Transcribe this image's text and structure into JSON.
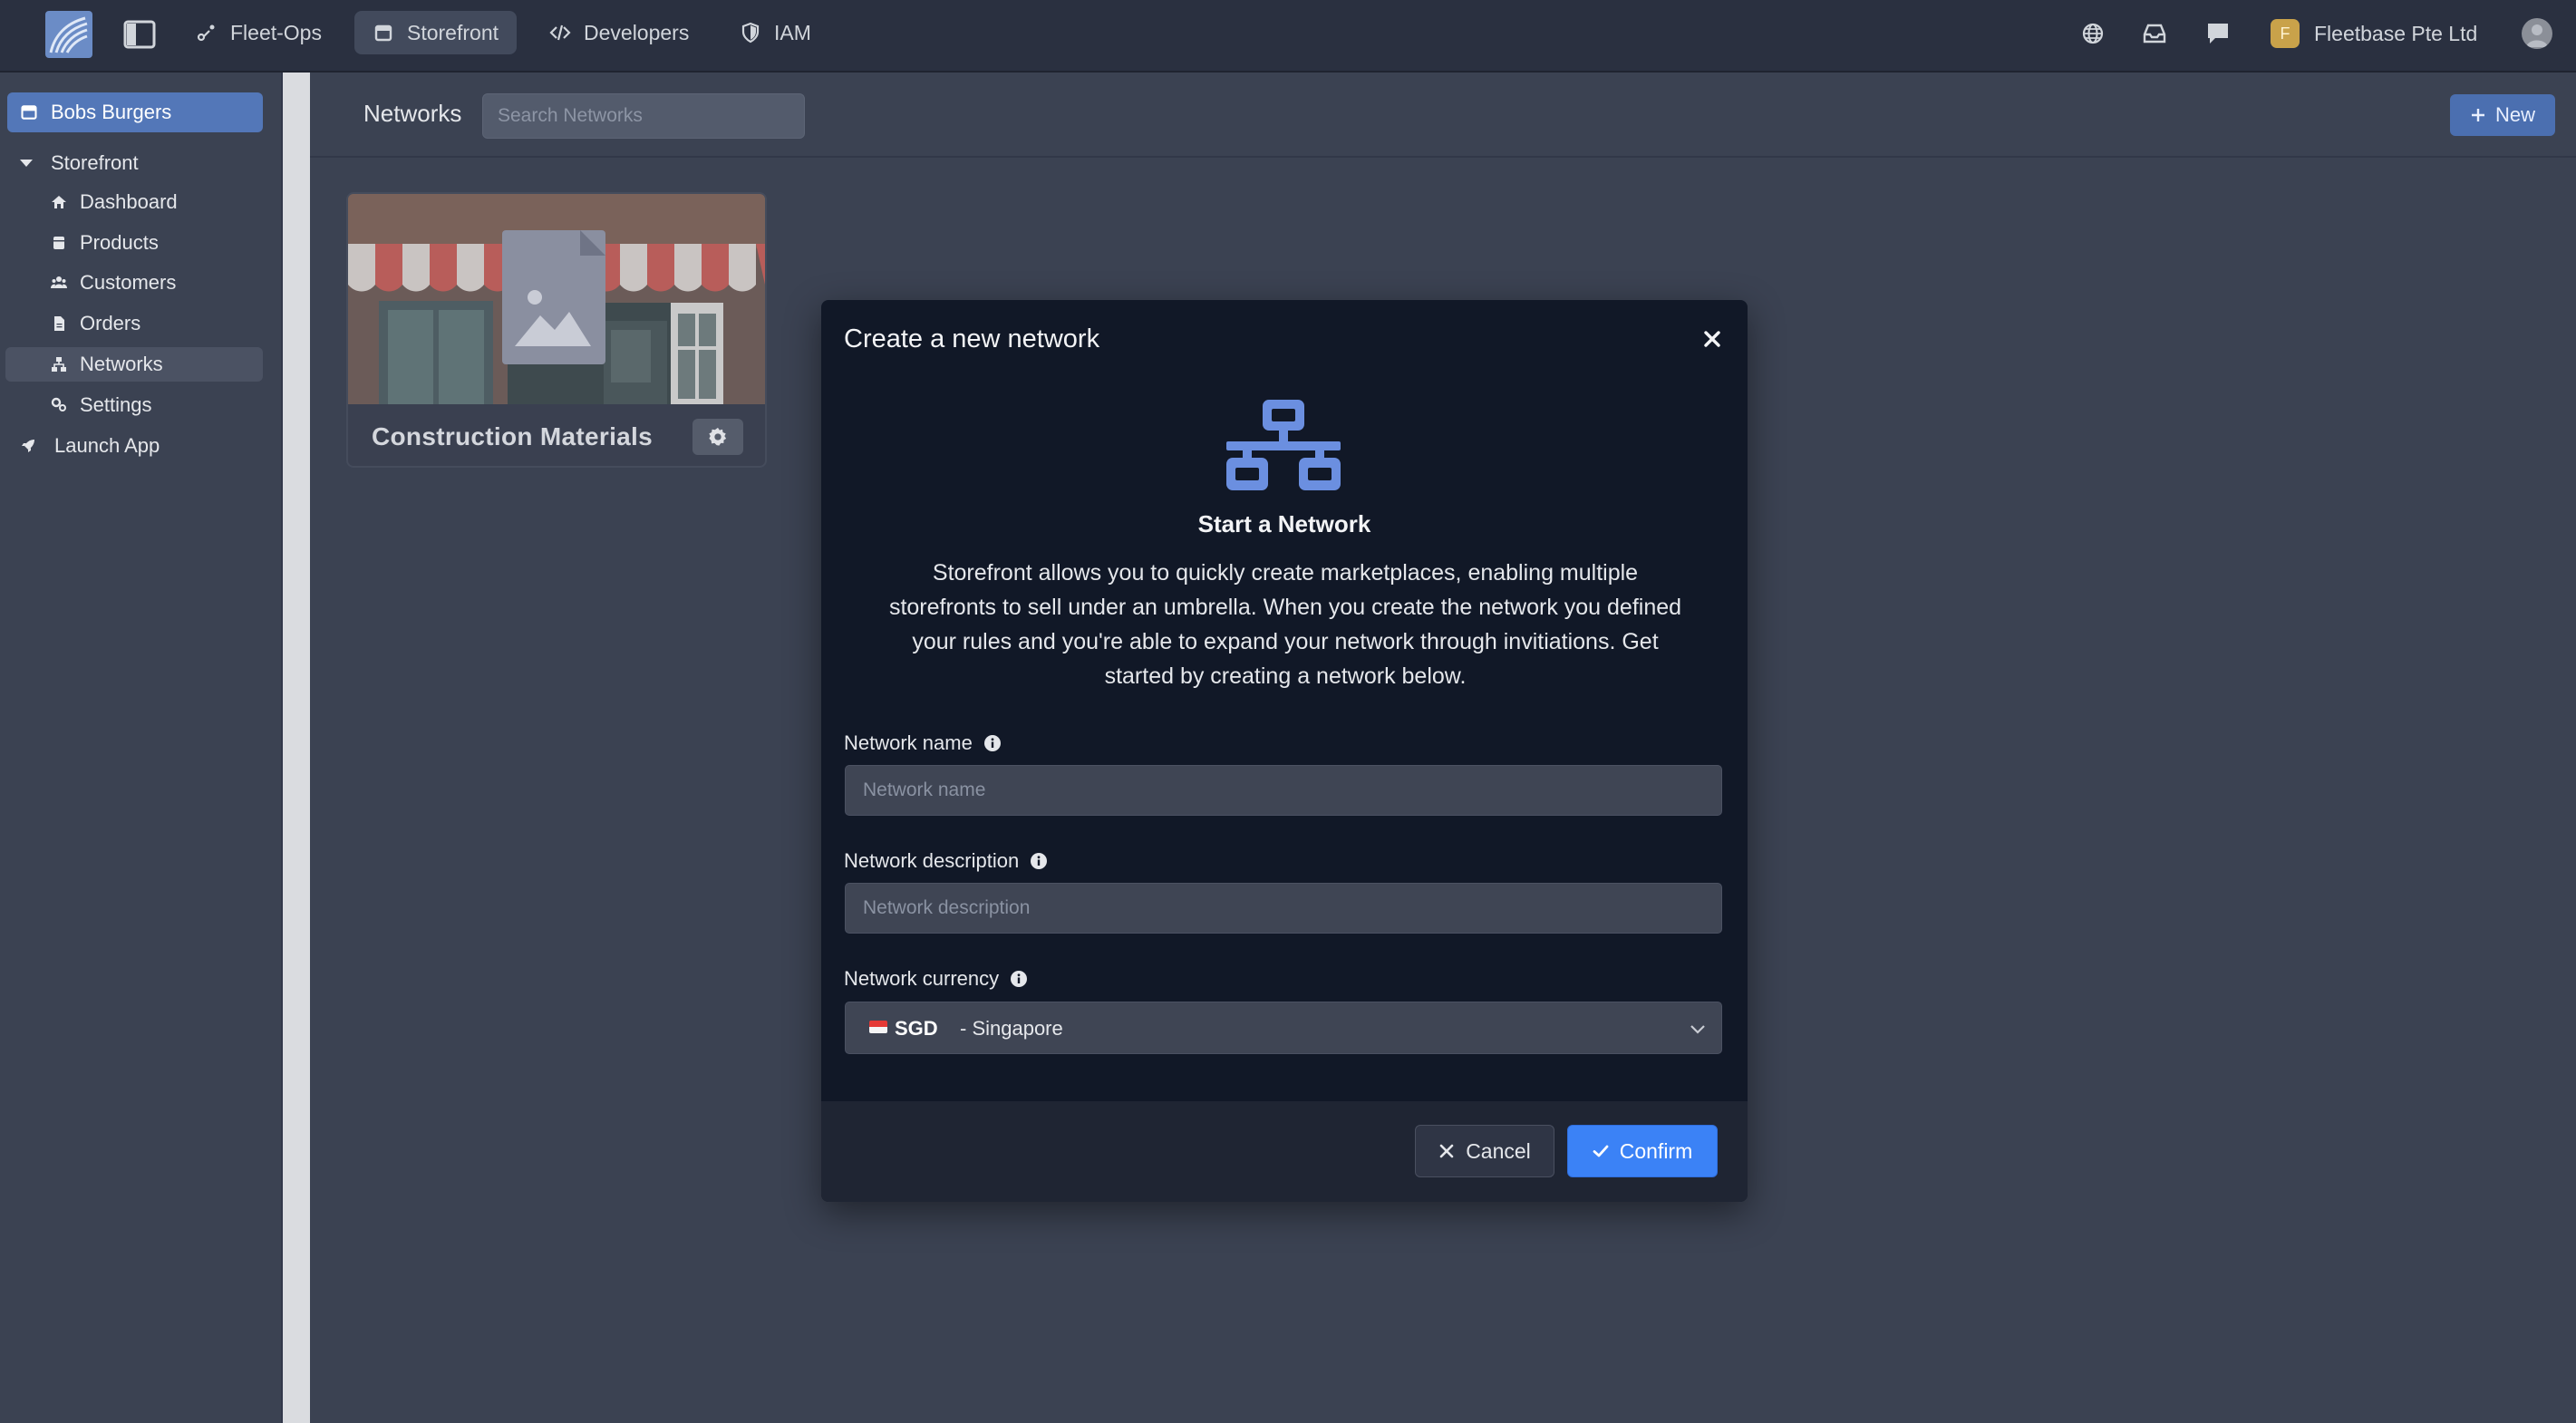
{
  "topbar": {
    "tabs": [
      {
        "label": "Fleet-Ops",
        "icon": "route-icon",
        "active": false
      },
      {
        "label": "Storefront",
        "icon": "store-icon",
        "active": true
      },
      {
        "label": "Developers",
        "icon": "code-icon",
        "active": false
      },
      {
        "label": "IAM",
        "icon": "shield-icon",
        "active": false
      }
    ],
    "org_initial": "F",
    "org_name": "Fleetbase Pte Ltd"
  },
  "sidebar": {
    "store_name": "Bobs Burgers",
    "section_label": "Storefront",
    "items": [
      {
        "label": "Dashboard",
        "icon": "home-icon",
        "active": false
      },
      {
        "label": "Products",
        "icon": "box-icon",
        "active": false
      },
      {
        "label": "Customers",
        "icon": "users-icon",
        "active": false
      },
      {
        "label": "Orders",
        "icon": "file-icon",
        "active": false
      },
      {
        "label": "Networks",
        "icon": "network-icon",
        "active": true
      },
      {
        "label": "Settings",
        "icon": "gears-icon",
        "active": false
      }
    ],
    "launch_label": "Launch App"
  },
  "main": {
    "title": "Networks",
    "search_placeholder": "Search Networks",
    "new_label": "New",
    "cards": [
      {
        "title": "Construction Materials"
      }
    ]
  },
  "modal": {
    "title": "Create a new network",
    "hero_title": "Start a Network",
    "hero_text": "Storefront allows you to quickly create marketplaces, enabling multiple storefronts to sell under an umbrella. When you create the network you defined your rules and you're able to expand your network through invitiations. Get started by creating a network below.",
    "fields": {
      "name": {
        "label": "Network name",
        "placeholder": "Network name",
        "value": ""
      },
      "description": {
        "label": "Network description",
        "placeholder": "Network description",
        "value": ""
      },
      "currency": {
        "label": "Network currency",
        "code": "SGD",
        "name": "- Singapore"
      }
    },
    "cancel_label": "Cancel",
    "confirm_label": "Confirm"
  },
  "colors": {
    "accent": "#3b82f6",
    "sidebar_active": "#5377b8",
    "modal_bg": "#111827",
    "page_bg": "#3b4252"
  }
}
